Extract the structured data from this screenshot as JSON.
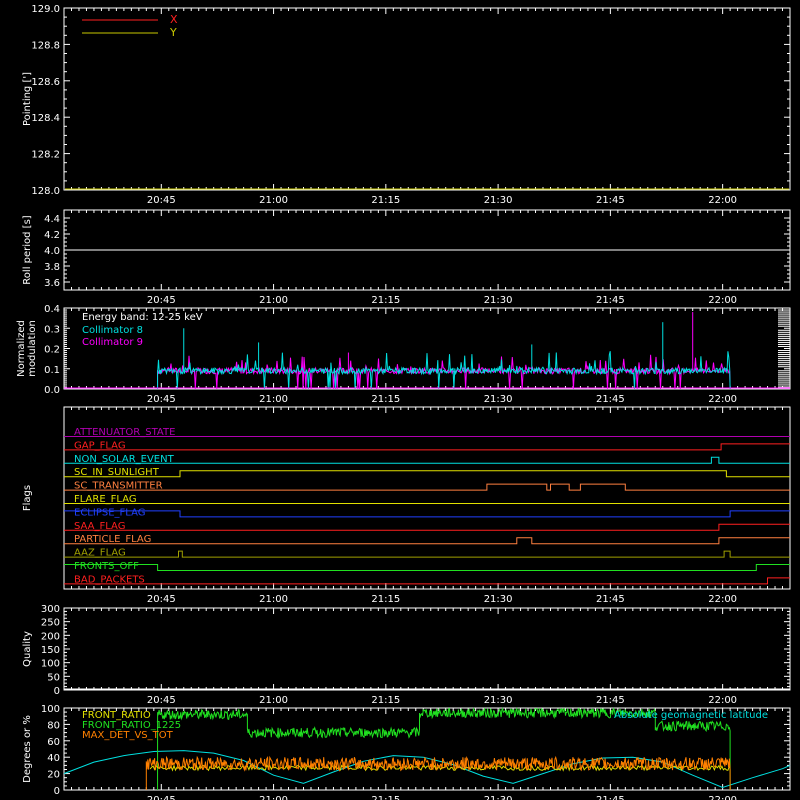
{
  "colors": {
    "x": "#ff2020",
    "y": "#c8c800",
    "white": "#ffffff",
    "coll8": "#00e0e0",
    "coll9": "#ff00ff",
    "attenuator": "#b000b0",
    "gap": "#ff2020",
    "nonsolar": "#00e0e0",
    "sunlight": "#e0e000",
    "transmitter": "#ff8040",
    "flare": "#e0e000",
    "eclipse": "#2040ff",
    "saa": "#ff2020",
    "particle": "#ff8040",
    "aaz": "#a0a000",
    "fronts_off": "#20e020",
    "bad_packets": "#ff2020",
    "front_ratio": "#e0e000",
    "front_ratio_1225": "#20e020",
    "max_det": "#ff8000",
    "geomag": "#00e0e0"
  },
  "time_axis": {
    "min_minutes": 1232,
    "max_minutes": 1329,
    "ticks": [
      {
        "m": 1245,
        "label": "20:45"
      },
      {
        "m": 1260,
        "label": "21:00"
      },
      {
        "m": 1275,
        "label": "21:15"
      },
      {
        "m": 1290,
        "label": "21:30"
      },
      {
        "m": 1305,
        "label": "21:45"
      },
      {
        "m": 1320,
        "label": "22:00"
      }
    ]
  },
  "chart_data": [
    {
      "type": "line",
      "id": "pointing",
      "ylabel": "Pointing [']",
      "ylim": [
        128.0,
        129.0
      ],
      "yticks": [
        "128.0",
        "128.2",
        "128.4",
        "128.6",
        "128.8",
        "129.0"
      ],
      "legend": [
        {
          "name": "X",
          "color": "x"
        },
        {
          "name": "Y",
          "color": "y"
        }
      ],
      "series": [
        {
          "name": "Y",
          "color": "y",
          "constant": 128.0
        }
      ]
    },
    {
      "type": "line",
      "id": "roll",
      "ylabel": "Roll period [s]",
      "ylim": [
        3.5,
        4.5
      ],
      "yticks": [
        "3.6",
        "3.8",
        "4.0",
        "4.2",
        "4.4"
      ],
      "series": [
        {
          "name": "roll",
          "color": "white",
          "constant": 4.0
        }
      ]
    },
    {
      "type": "line",
      "id": "modulation",
      "ylabel": "Normalized modulation",
      "ylim": [
        0.0,
        0.4
      ],
      "yticks": [
        "0.0",
        "0.1",
        "0.2",
        "0.3",
        "0.4"
      ],
      "annotation": "Energy band: 12-25 keV",
      "legend": [
        {
          "name": "Collimator 8",
          "color": "coll8"
        },
        {
          "name": "Collimator 9",
          "color": "coll9"
        }
      ],
      "data_start": 1244.5,
      "data_end": 1321.0,
      "baseline": 0.09
    },
    {
      "type": "line",
      "id": "flags",
      "ylabel": "Flags",
      "flags": [
        {
          "name": "ATTENUATOR_STATE",
          "color": "attenuator",
          "segments": [
            [
              1232,
              0
            ],
            [
              1329,
              0
            ]
          ]
        },
        {
          "name": "GAP_FLAG",
          "color": "gap",
          "segments": [
            [
              1232,
              0
            ],
            [
              1319.8,
              0
            ],
            [
              1319.8,
              1
            ],
            [
              1329,
              1
            ]
          ]
        },
        {
          "name": "NON_SOLAR_EVENT",
          "color": "nonsolar",
          "segments": [
            [
              1232,
              0
            ],
            [
              1318.5,
              0
            ],
            [
              1318.5,
              1
            ],
            [
              1319.5,
              1
            ],
            [
              1319.5,
              0
            ],
            [
              1329,
              0
            ]
          ]
        },
        {
          "name": "SC_IN_SUNLIGHT",
          "color": "sunlight",
          "segments": [
            [
              1232,
              0
            ],
            [
              1247.5,
              0
            ],
            [
              1247.5,
              1
            ],
            [
              1320.5,
              1
            ],
            [
              1320.5,
              0
            ],
            [
              1329,
              0
            ]
          ]
        },
        {
          "name": "SC_TRANSMITTER",
          "color": "transmitter",
          "segments": [
            [
              1232,
              0
            ],
            [
              1288.5,
              0
            ],
            [
              1288.5,
              1
            ],
            [
              1296.5,
              1
            ],
            [
              1296.5,
              0
            ],
            [
              1297,
              0
            ],
            [
              1297,
              1
            ],
            [
              1299.5,
              1
            ],
            [
              1299.5,
              0
            ],
            [
              1301,
              0
            ],
            [
              1301,
              1
            ],
            [
              1307,
              1
            ],
            [
              1307,
              0
            ],
            [
              1329,
              0
            ]
          ]
        },
        {
          "name": "FLARE_FLAG",
          "color": "flare",
          "segments": [
            [
              1232,
              0
            ],
            [
              1329,
              0
            ]
          ]
        },
        {
          "name": "ECLIPSE_FLAG",
          "color": "eclipse",
          "segments": [
            [
              1232,
              1
            ],
            [
              1247.5,
              1
            ],
            [
              1247.5,
              0
            ],
            [
              1321,
              0
            ],
            [
              1321,
              1
            ],
            [
              1329,
              1
            ]
          ]
        },
        {
          "name": "SAA_FLAG",
          "color": "saa",
          "segments": [
            [
              1232,
              0
            ],
            [
              1319.5,
              0
            ],
            [
              1319.5,
              1
            ],
            [
              1329,
              1
            ]
          ]
        },
        {
          "name": "PARTICLE_FLAG",
          "color": "particle",
          "segments": [
            [
              1232,
              0
            ],
            [
              1292.5,
              0
            ],
            [
              1292.5,
              1
            ],
            [
              1294.5,
              1
            ],
            [
              1294.5,
              0
            ],
            [
              1319.5,
              0
            ],
            [
              1319.5,
              1
            ],
            [
              1329,
              1
            ]
          ]
        },
        {
          "name": "AAZ_FLAG",
          "color": "aaz",
          "segments": [
            [
              1232,
              0
            ],
            [
              1247.3,
              0
            ],
            [
              1247.3,
              1
            ],
            [
              1247.8,
              1
            ],
            [
              1247.8,
              0
            ],
            [
              1320.2,
              0
            ],
            [
              1320.2,
              1
            ],
            [
              1321,
              1
            ],
            [
              1321,
              0
            ],
            [
              1329,
              0
            ]
          ]
        },
        {
          "name": "FRONTS_OFF",
          "color": "fronts_off",
          "segments": [
            [
              1232,
              1
            ],
            [
              1244.5,
              1
            ],
            [
              1244.5,
              0
            ],
            [
              1324.5,
              0
            ],
            [
              1324.5,
              1
            ],
            [
              1329,
              1
            ]
          ]
        },
        {
          "name": "BAD_PACKETS",
          "color": "bad_packets",
          "segments": [
            [
              1232,
              0
            ],
            [
              1326,
              0
            ],
            [
              1326,
              1
            ],
            [
              1329,
              1
            ]
          ]
        }
      ]
    },
    {
      "type": "line",
      "id": "quality",
      "ylabel": "Quality",
      "ylim": [
        0,
        300
      ],
      "yticks": [
        "0",
        "50",
        "100",
        "150",
        "200",
        "250",
        "300"
      ],
      "series": [
        {
          "name": "quality",
          "color": "white",
          "constant": 0
        }
      ]
    },
    {
      "type": "line",
      "id": "ratios",
      "ylabel": "Degrees or %",
      "ylim": [
        0,
        100
      ],
      "yticks": [
        "0",
        "20",
        "40",
        "60",
        "80",
        "100"
      ],
      "legend": [
        {
          "name": "FRONT_RATIO",
          "color": "front_ratio"
        },
        {
          "name": "FRONT_RATIO_1225",
          "color": "front_ratio_1225"
        },
        {
          "name": "MAX_DET_VS_TOT",
          "color": "max_det"
        }
      ],
      "legend_right": {
        "name": "Absolute geomagnetic latitude",
        "color": "geomag"
      },
      "front_ratio_1225_levels": [
        {
          "from": 1244.5,
          "to": 1256.5,
          "value": 92
        },
        {
          "from": 1256.5,
          "to": 1279.5,
          "value": 70
        },
        {
          "from": 1279.5,
          "to": 1311,
          "value": 94
        },
        {
          "from": 1311,
          "to": 1321,
          "value": 78
        }
      ],
      "max_det_level": 32,
      "geomag_series": {
        "x": [
          1232,
          1236,
          1240,
          1244,
          1248,
          1252,
          1256,
          1260,
          1264,
          1268,
          1272,
          1276,
          1280,
          1284,
          1288,
          1292,
          1296,
          1300,
          1304,
          1308,
          1312,
          1316,
          1320,
          1324,
          1328,
          1329
        ],
        "values": [
          20,
          34,
          42,
          47,
          48,
          45,
          36,
          18,
          8,
          22,
          35,
          42,
          40,
          31,
          17,
          8,
          20,
          32,
          39,
          40,
          34,
          18,
          3,
          15,
          26,
          30
        ]
      }
    }
  ]
}
